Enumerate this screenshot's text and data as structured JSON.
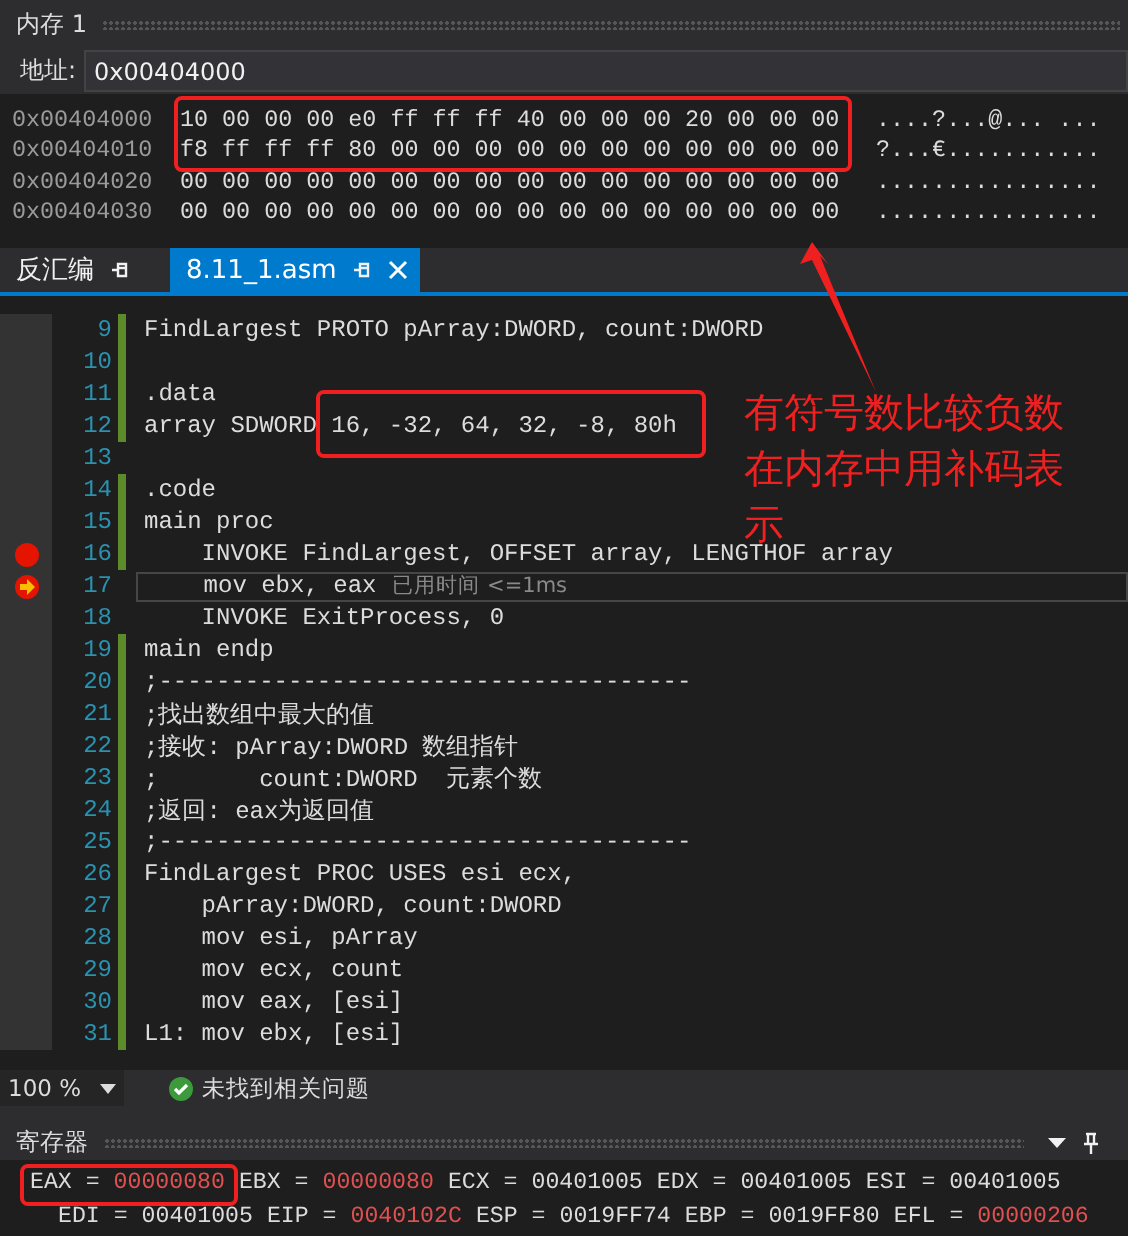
{
  "memory_panel": {
    "title": "内存 1",
    "address_label": "地址:",
    "address": "0x00404000",
    "rows": [
      {
        "address": "0x00404000",
        "bytes": "10 00 00 00 e0 ff ff ff 40 00 00 00 20 00 00 00",
        "ascii": "....?...@... ..."
      },
      {
        "address": "0x00404010",
        "bytes": "f8 ff ff ff 80 00 00 00 00 00 00 00 00 00 00 00",
        "ascii": "?...€..........."
      },
      {
        "address": "0x00404020",
        "bytes": "00 00 00 00 00 00 00 00 00 00 00 00 00 00 00 00",
        "ascii": "................"
      },
      {
        "address": "0x00404030",
        "bytes": "00 00 00 00 00 00 00 00 00 00 00 00 00 00 00 00",
        "ascii": "................"
      }
    ]
  },
  "tabs": [
    {
      "label": "反汇编",
      "selected": false,
      "closable": false
    },
    {
      "label": "8.11_1.asm",
      "selected": true,
      "closable": true
    }
  ],
  "editor": {
    "lines": [
      {
        "number": "9",
        "text": "FindLargest PROTO pArray:DWORD, count:DWORD",
        "changed": true,
        "breakpoint": false,
        "current": false
      },
      {
        "number": "10",
        "changed": true,
        "breakpoint": false,
        "current": false
      },
      {
        "number": "11",
        "text": ".data",
        "changed": true,
        "breakpoint": false,
        "current": false
      },
      {
        "number": "12",
        "text": "array SDWORD 16, -32, 64, 32, -8, 80h",
        "changed": true,
        "breakpoint": false,
        "current": false
      },
      {
        "number": "13",
        "changed": false,
        "breakpoint": false,
        "current": false
      },
      {
        "number": "14",
        "text": ".code",
        "changed": true,
        "breakpoint": false,
        "current": false
      },
      {
        "number": "15",
        "text": "main proc",
        "changed": true,
        "breakpoint": false,
        "current": false
      },
      {
        "number": "16",
        "text": "    INVOKE FindLargest, OFFSET array, LENGTHOF array",
        "changed": true,
        "breakpoint": true,
        "current": false
      },
      {
        "number": "17",
        "text": "    mov ebx, eax",
        "changed": false,
        "breakpoint": true,
        "current": true,
        "hint": "已用时间 <=1ms"
      },
      {
        "number": "18",
        "text": "    INVOKE ExitProcess, 0",
        "changed": false,
        "breakpoint": false,
        "current": false
      },
      {
        "number": "19",
        "text": "main endp",
        "changed": true,
        "breakpoint": false,
        "current": false
      },
      {
        "number": "20",
        "text": ";-------------------------------------",
        "changed": true,
        "breakpoint": false,
        "current": false
      },
      {
        "number": "21",
        "text": ";找出数组中最大的值",
        "changed": true,
        "breakpoint": false,
        "current": false
      },
      {
        "number": "22",
        "text": ";接收: pArray:DWORD 数组指针",
        "changed": true,
        "breakpoint": false,
        "current": false
      },
      {
        "number": "23",
        "text": ";       count:DWORD  元素个数",
        "changed": true,
        "breakpoint": false,
        "current": false
      },
      {
        "number": "24",
        "text": ";返回: eax为返回值",
        "changed": true,
        "breakpoint": false,
        "current": false
      },
      {
        "number": "25",
        "text": ";-------------------------------------",
        "changed": true,
        "breakpoint": false,
        "current": false
      },
      {
        "number": "26",
        "text": "FindLargest PROC USES esi ecx,",
        "changed": true,
        "breakpoint": false,
        "current": false
      },
      {
        "number": "27",
        "text": "    pArray:DWORD, count:DWORD",
        "changed": true,
        "breakpoint": false,
        "current": false
      },
      {
        "number": "28",
        "text": "    mov esi, pArray",
        "changed": true,
        "breakpoint": false,
        "current": false
      },
      {
        "number": "29",
        "text": "    mov ecx, count",
        "changed": true,
        "breakpoint": false,
        "current": false
      },
      {
        "number": "30",
        "text": "    mov eax, [esi]",
        "changed": true,
        "breakpoint": false,
        "current": false
      },
      {
        "number": "31",
        "text": "L1: mov ebx, [esi]",
        "changed": true,
        "breakpoint": false,
        "current": false
      }
    ]
  },
  "status_bar": {
    "zoom": "100 %",
    "issues": "未找到相关问题"
  },
  "registers_panel": {
    "title": "寄存器",
    "rows": [
      [
        {
          "name": "EAX =",
          "value": "00000080",
          "changed": true
        },
        {
          "name": "EBX =",
          "value": "00000080",
          "changed": true
        },
        {
          "name": "ECX =",
          "value": "00401005",
          "changed": false
        },
        {
          "name": "EDX =",
          "value": "00401005",
          "changed": false
        },
        {
          "name": "ESI =",
          "value": "00401005",
          "changed": false
        }
      ],
      [
        {
          "name": "EDI =",
          "value": "00401005",
          "changed": false
        },
        {
          "name": "EIP =",
          "value": "0040102C",
          "changed": true
        },
        {
          "name": "ESP =",
          "value": "0019FF74",
          "changed": false
        },
        {
          "name": "EBP =",
          "value": "0019FF80",
          "changed": false
        },
        {
          "name": "EFL =",
          "value": "00000206",
          "changed": true
        }
      ]
    ]
  },
  "annotation": {
    "text": "有符号数比较负数在内存中用补码表示"
  }
}
